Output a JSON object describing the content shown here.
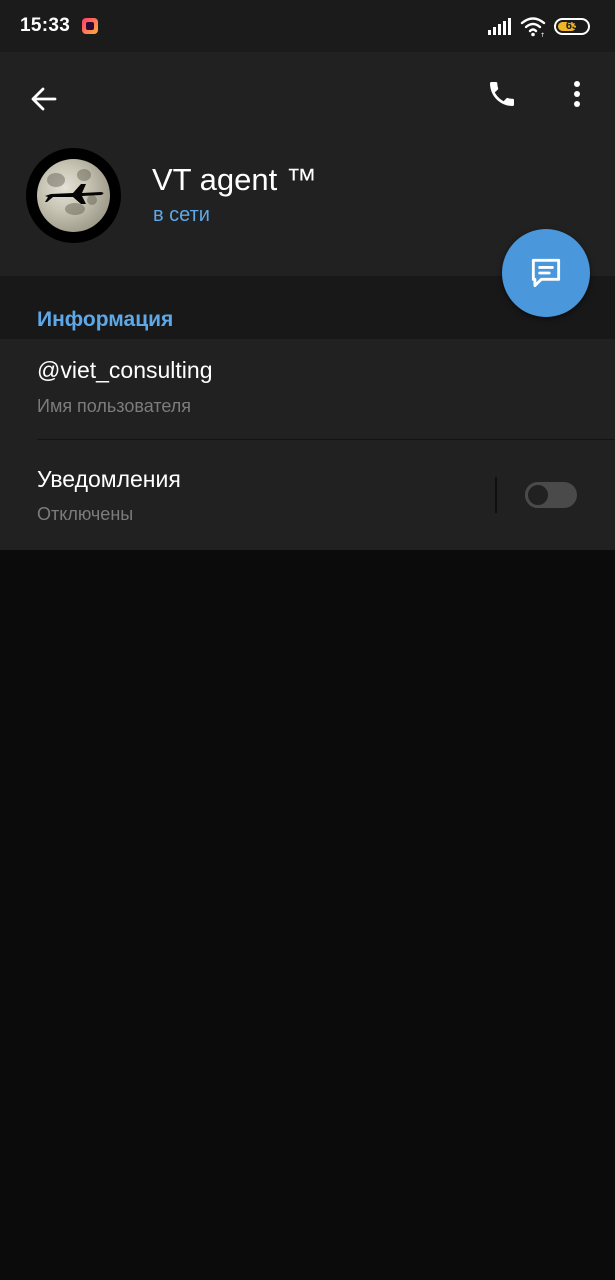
{
  "status_bar": {
    "time": "15:33",
    "battery_level": "63",
    "battery_fraction": 0.63,
    "battery_color": "#f0b429",
    "icons": [
      "app-notification-icon",
      "signal-icon",
      "wifi-icon",
      "battery-icon"
    ]
  },
  "header": {
    "back_icon": "arrow-left-icon",
    "call_icon": "phone-icon",
    "menu_icon": "more-vertical-icon"
  },
  "profile": {
    "name": "VT agent ™",
    "status": "в сети",
    "avatar": "moon-with-airplane-silhouette"
  },
  "fab": {
    "icon": "message-icon",
    "color": "#4a97dc"
  },
  "info_section": {
    "title": "Информация",
    "username": {
      "value": "@viet_consulting",
      "label": "Имя пользователя"
    },
    "notifications": {
      "title": "Уведомления",
      "value": "Отключены",
      "enabled": false
    }
  },
  "colors": {
    "accent": "#5ea8e8",
    "background": "#0b0b0b",
    "header_background": "#212121",
    "secondary_text": "#7c7c7c"
  }
}
